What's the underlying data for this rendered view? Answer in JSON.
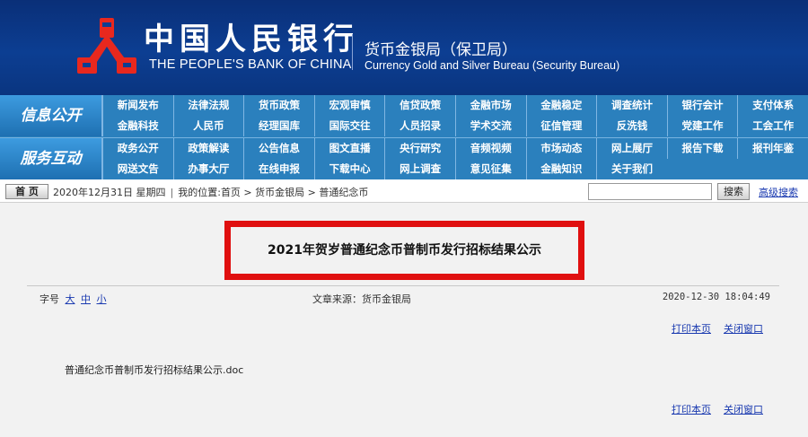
{
  "header": {
    "bank_name_cn": "中国人民银行",
    "bank_name_en": "THE PEOPLE'S BANK OF CHINA",
    "bureau_cn": "货币金银局（保卫局）",
    "bureau_en": "Currency  Gold and Silver Bureau (Security Bureau)",
    "logo_icon": "pboc-logo-icon",
    "colors": {
      "banner": "#0c3e92",
      "logo": "#e8281e"
    }
  },
  "nav": {
    "colors": {
      "bar": "#2b80bd",
      "text": "#ffffff"
    },
    "groups": [
      {
        "title": "信息公开",
        "rows": [
          [
            "新闻发布",
            "法律法规",
            "货币政策",
            "宏观审慎",
            "信贷政策",
            "金融市场",
            "金融稳定",
            "调查统计",
            "银行会计",
            "支付体系"
          ],
          [
            "金融科技",
            "人民币",
            "经理国库",
            "国际交往",
            "人员招录",
            "学术交流",
            "征信管理",
            "反洗钱",
            "党建工作",
            "工会工作"
          ]
        ]
      },
      {
        "title": "服务互动",
        "rows": [
          [
            "政务公开",
            "政策解读",
            "公告信息",
            "图文直播",
            "央行研究",
            "音频视频",
            "市场动态",
            "网上展厅",
            "报告下载",
            "报刊年鉴"
          ],
          [
            "网送文告",
            "办事大厅",
            "在线申报",
            "下载中心",
            "网上调查",
            "意见征集",
            "金融知识",
            "关于我们"
          ]
        ]
      }
    ]
  },
  "breadcrumb": {
    "home_label": "首 页",
    "date": "2020年12月31日 星期四",
    "location_prefix": "我的位置:",
    "path": "首页 > 货币金银局 > 普通纪念币",
    "search_placeholder": "",
    "search_button": "搜索",
    "advanced_search": "高级搜索"
  },
  "article": {
    "title": "2021年贺岁普通纪念币普制币发行招标结果公示",
    "font_size_label": "字号",
    "font_sizes": [
      "大",
      "中",
      "小"
    ],
    "source": "文章来源：货币金银局",
    "timestamp": "2020-12-30  18:04:49",
    "print_label": "打印本页",
    "close_label": "关闭窗口",
    "attachment": "普通纪念币普制币发行招标结果公示.doc",
    "highlight_color": "#e01010"
  }
}
